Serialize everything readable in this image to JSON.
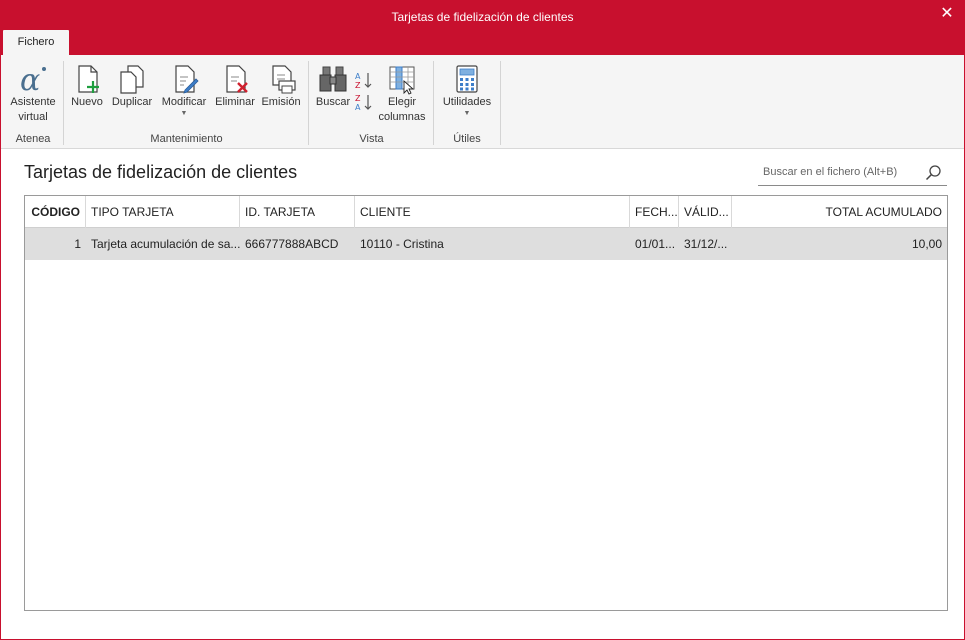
{
  "window": {
    "title": "Tarjetas de fidelización de clientes",
    "close_glyph": "✕"
  },
  "ribbon": {
    "tab": "Fichero",
    "groups": {
      "atenea": "Atenea",
      "mantenimiento": "Mantenimiento",
      "vista": "Vista",
      "utiles": "Útiles"
    },
    "buttons": {
      "asistente_line1": "Asistente",
      "asistente_line2": "virtual",
      "nuevo": "Nuevo",
      "duplicar": "Duplicar",
      "modificar": "Modificar",
      "eliminar": "Eliminar",
      "emision": "Emisión",
      "buscar": "Buscar",
      "elegir_line1": "Elegir",
      "elegir_line2": "columnas",
      "utilidades": "Utilidades"
    },
    "accent": "#c8102e"
  },
  "main": {
    "title": "Tarjetas de fidelización de clientes",
    "search_placeholder": "Buscar en el fichero (Alt+B)"
  },
  "table": {
    "headers": {
      "codigo": "CÓDIGO",
      "tipo": "TIPO TARJETA",
      "id": "ID. TARJETA",
      "cliente": "CLIENTE",
      "fecha": "FECH...",
      "valido": "VÁLID...",
      "total": "TOTAL ACUMULADO"
    },
    "rows": [
      {
        "codigo": "1",
        "tipo": "Tarjeta acumulación de sa...",
        "id": "666777888ABCD",
        "cliente": "10110 - Cristina",
        "fecha": "01/01...",
        "valido": "31/12/...",
        "total": "10,00"
      }
    ]
  }
}
